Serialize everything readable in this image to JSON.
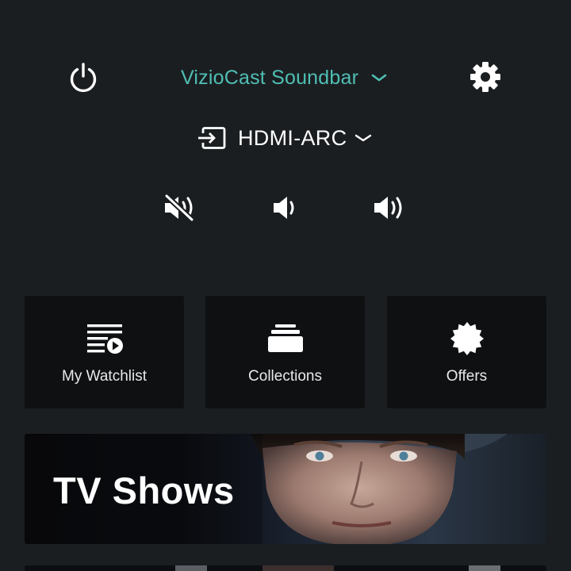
{
  "header": {
    "device_name": "VizioCast Soundbar",
    "input_label": "HDMI-ARC"
  },
  "icons": {
    "power": "power-icon",
    "device_dropdown": "chevron-down-icon",
    "settings": "gear-icon",
    "input": "input-source-icon",
    "input_dropdown": "chevron-down-icon",
    "mute": "volume-mute-icon",
    "volume_down": "volume-down-icon",
    "volume_up": "volume-up-icon"
  },
  "tiles": [
    {
      "label": "My Watchlist",
      "icon": "watchlist-icon"
    },
    {
      "label": "Collections",
      "icon": "collections-icon"
    },
    {
      "label": "Offers",
      "icon": "offers-badge-icon"
    }
  ],
  "banner": {
    "title": "TV Shows"
  },
  "colors": {
    "background": "#1b1e21",
    "accent": "#4fbfb4",
    "tile_background": "#0f1012",
    "text": "#ffffff"
  }
}
